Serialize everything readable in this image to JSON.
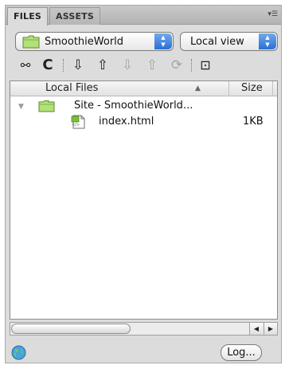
{
  "tabs": [
    {
      "label": "FILES",
      "active": true
    },
    {
      "label": "ASSETS",
      "active": false
    }
  ],
  "panel_menu_icon": "panel-options-icon",
  "site_select": {
    "value": "SmoothieWorld",
    "icon": "site-folder-icon"
  },
  "view_select": {
    "value": "Local view"
  },
  "toolbar": [
    {
      "name": "connect-icon",
      "glyph": "⚯",
      "enabled": true
    },
    {
      "name": "refresh-icon",
      "glyph": "C",
      "enabled": true
    },
    {
      "name": "get-files-icon",
      "glyph": "⇩",
      "enabled": true
    },
    {
      "name": "put-files-icon",
      "glyph": "⇧",
      "enabled": true
    },
    {
      "name": "check-out-icon",
      "glyph": "⇩",
      "enabled": false
    },
    {
      "name": "check-in-icon",
      "glyph": "⇧",
      "enabled": false
    },
    {
      "name": "synchronize-icon",
      "glyph": "⟳",
      "enabled": false
    },
    {
      "name": "expand-icon",
      "glyph": "⊡",
      "enabled": true
    }
  ],
  "filelist": {
    "columns": {
      "local": "Local Files",
      "size": "Size"
    },
    "rows": [
      {
        "name": "Site - SmoothieWorld...",
        "size": "",
        "type": "site-folder"
      },
      {
        "name": "index.html",
        "size": "1KB",
        "type": "html-file"
      }
    ]
  },
  "status": {
    "log_label": "Log..."
  },
  "colors": {
    "panel_bg": "#dcdcdc",
    "folder_green": "#9fd25a",
    "stepper_blue": "#2a6fd3"
  }
}
